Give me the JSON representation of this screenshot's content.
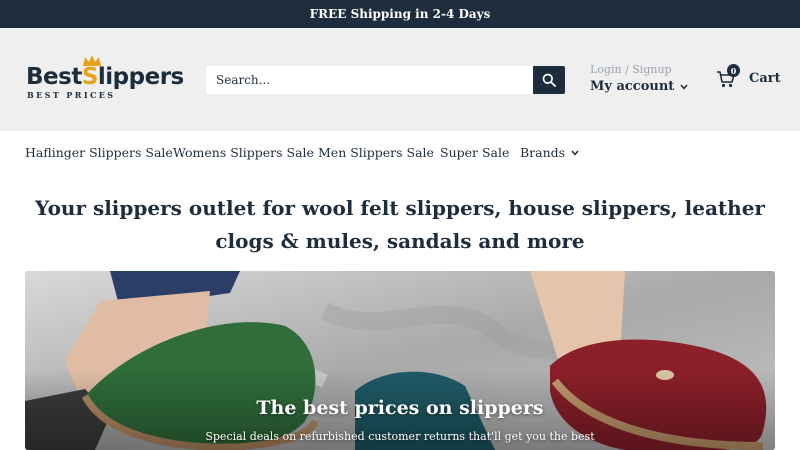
{
  "announcement": "FREE Shipping in 2-4 Days",
  "logo": {
    "brand_first": "Best",
    "brand_s": "S",
    "brand_rest": "lippers",
    "tagline": "BEST PRICES"
  },
  "search": {
    "placeholder": "Search..."
  },
  "account": {
    "login_signup": "Login / Signup",
    "my_account": "My account"
  },
  "cart": {
    "count": "0",
    "label": "Cart"
  },
  "nav": {
    "items": [
      {
        "label": "Haflinger Slippers Sale"
      },
      {
        "label": "Womens Slippers Sale"
      },
      {
        "label": "Men Slippers Sale"
      },
      {
        "label": "Super Sale"
      },
      {
        "label": "Brands"
      }
    ]
  },
  "headline": "Your slippers outlet for wool felt slippers, house slippers, leather clogs & mules, sandals and more",
  "hero": {
    "title": "The best prices on slippers",
    "subtitle": "Special deals on refurbished customer returns that'll get you the best"
  },
  "colors": {
    "navy": "#1e2d3d",
    "gold": "#e8a21a",
    "header_bg": "#efefef"
  }
}
